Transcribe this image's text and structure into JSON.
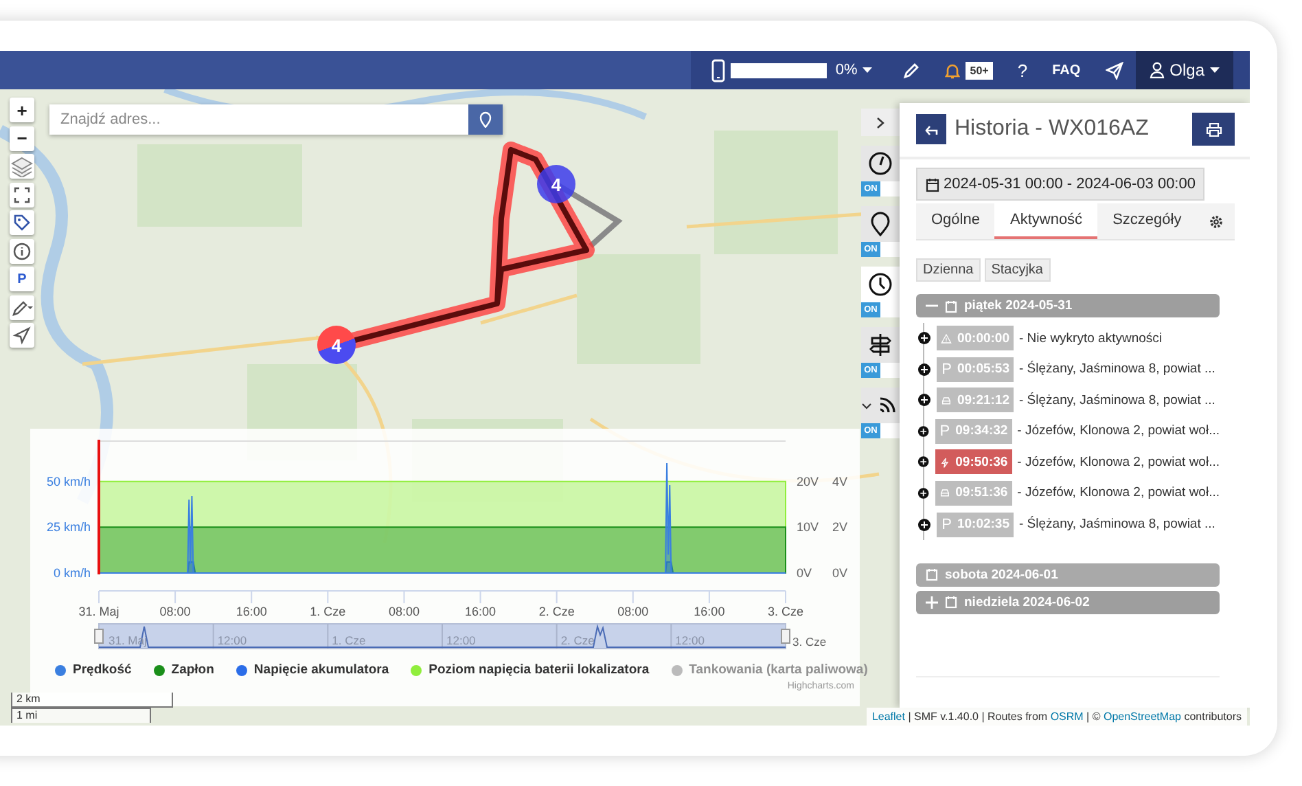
{
  "navbar": {
    "progress": {
      "level": 0,
      "reading": "0%"
    },
    "notifications_badge": "50+",
    "help": "?",
    "faq": "FAQ",
    "user": "Olga"
  },
  "map": {
    "search": {
      "placeholder": "Znajdź adres..."
    },
    "controls": [
      {
        "kind": "zoom_in",
        "label": "+"
      },
      {
        "kind": "zoom_out",
        "label": "−"
      },
      {
        "kind": "layers"
      },
      {
        "kind": "fullscreen"
      },
      {
        "kind": "tag"
      },
      {
        "kind": "info"
      },
      {
        "kind": "parking",
        "label": "P"
      },
      {
        "kind": "draw"
      },
      {
        "kind": "locate"
      }
    ],
    "markers": [
      {
        "kind": "start",
        "label": "4"
      },
      {
        "kind": "cluster",
        "label": "4"
      }
    ],
    "scale": [
      "2 km",
      "1 mi"
    ],
    "layer_toggles": [
      {
        "kind": "speed",
        "on": true,
        "selected": false,
        "label": "ON"
      },
      {
        "kind": "pin",
        "on": true,
        "selected": false,
        "label": "ON"
      },
      {
        "kind": "clock",
        "on": true,
        "selected": true,
        "label": "ON"
      },
      {
        "kind": "signpost",
        "on": true,
        "selected": false,
        "label": "ON"
      },
      {
        "kind": "signal",
        "on": true,
        "selected": false,
        "label": "ON"
      }
    ],
    "attribution": [
      {
        "text": "Leaflet",
        "link": true
      },
      {
        "text": "| SMF v.1.40.0 | Routes from",
        "link": false
      },
      {
        "text": "OSRM",
        "link": true
      },
      {
        "text": "| ©",
        "link": false
      },
      {
        "text": "OpenStreetMap",
        "link": true
      },
      {
        "text": "contributors",
        "link": false
      }
    ]
  },
  "chart": {
    "chart_data": {
      "type": "area",
      "x": [
        "2024-05-31 00:00",
        "2024-05-31 09:18",
        "2024-05-31 09:27",
        "2024-05-31 09:36",
        "2024-05-31 09:45",
        "2024-05-31 09:54",
        "2024-05-31 10:06",
        "2024-06-02 11:24",
        "2024-06-02 11:33",
        "2024-06-02 11:42",
        "2024-06-02 11:51",
        "2024-06-02 12:00",
        "2024-06-02 12:12",
        "2024-06-03 00:00"
      ],
      "xlim": [
        "2024-05-31 00:00",
        "2024-06-03 00:00"
      ],
      "ylim": [
        0,
        72
      ],
      "xticks": [
        {
          "value": "2024-05-31 00:00",
          "label": "31. Maj"
        },
        {
          "value": "2024-05-31 08:00",
          "label": "08:00"
        },
        {
          "value": "2024-05-31 16:00",
          "label": "16:00"
        },
        {
          "value": "2024-06-01 00:00",
          "label": "1. Cze"
        },
        {
          "value": "2024-06-01 08:00",
          "label": "08:00"
        },
        {
          "value": "2024-06-01 16:00",
          "label": "16:00"
        },
        {
          "value": "2024-06-02 00:00",
          "label": "2. Cze"
        },
        {
          "value": "2024-06-02 08:00",
          "label": "08:00"
        },
        {
          "value": "2024-06-02 16:00",
          "label": "16:00"
        },
        {
          "value": "2024-06-03 00:00",
          "label": "3. Cze"
        }
      ],
      "yticks": [
        {
          "value": 0,
          "label": "0 km/h"
        },
        {
          "value": 25,
          "label": "25 km/h"
        },
        {
          "value": 50,
          "label": "50 km/h"
        }
      ],
      "series": [
        {
          "name": "Prędkość",
          "color": "#3a7fe0",
          "values": [
            0,
            0,
            40,
            5,
            42,
            0,
            0,
            0,
            60,
            10,
            48,
            0,
            0,
            0
          ]
        },
        {
          "name": "Zapłon",
          "color": "#1a8f1a",
          "values": [
            25,
            25,
            25,
            25,
            25,
            25,
            25,
            25,
            25,
            25,
            25,
            25,
            25,
            25
          ]
        },
        {
          "name": "Napięcie akumulatora",
          "color": "#2b6de8",
          "values": [
            0,
            0,
            6,
            6,
            6,
            6,
            0,
            0,
            6,
            6,
            6,
            6,
            0,
            0
          ]
        },
        {
          "name": "Poziom napięcia baterii lokalizatora",
          "color": "#90ee3c",
          "values": [
            50,
            50,
            50,
            50,
            50,
            50,
            50,
            50,
            50,
            50,
            50,
            50,
            50,
            50
          ]
        },
        {
          "name": "Tankowania (karta paliwowa)",
          "color": "#bbbbbb",
          "values": [
            null,
            null,
            null,
            null,
            null,
            null,
            null,
            null,
            null,
            null,
            null,
            null,
            null,
            null
          ]
        }
      ]
    },
    "legend_states": [
      {
        "hidden": false
      },
      {
        "hidden": false
      },
      {
        "hidden": false
      },
      {
        "hidden": false
      },
      {
        "hidden": true
      }
    ],
    "right_axis_labels": [
      [
        "20V",
        "10V",
        "0V"
      ],
      [
        "4V",
        "2V",
        "0V"
      ]
    ],
    "navigator_labels": [
      "31. Maj",
      "12:00",
      "1. Cze",
      "12:00",
      "2. Cze",
      "12:00",
      "3. Cze"
    ],
    "credits": "Highcharts.com"
  },
  "panel": {
    "title": "Historia - WX016AZ",
    "date_range": "2024-05-31 00:00 - 2024-06-03 00:00",
    "tabs": [
      {
        "label": "Ogólne",
        "selected": false
      },
      {
        "label": "Aktywność",
        "selected": true
      },
      {
        "label": "Szczegóły",
        "selected": false
      }
    ],
    "filters": [
      "Dzienna",
      "Stacyjka"
    ],
    "days": [
      {
        "label": "piątek 2024-05-31",
        "expanded": true,
        "disabled": false,
        "events": [
          {
            "kind": "warning",
            "time": "00:00:00",
            "text": "- Nie wykryto aktywności"
          },
          {
            "kind": "parking",
            "symbol": "P",
            "time": "00:05:53",
            "text": "- Ślężany, Jaśminowa 8, powiat ..."
          },
          {
            "kind": "drive",
            "time": "09:21:12",
            "text": "- Ślężany, Jaśminowa 8, powiat ..."
          },
          {
            "kind": "parking",
            "symbol": "P",
            "time": "09:34:32",
            "text": "- Józefów, Klonowa 2, powiat woł..."
          },
          {
            "kind": "ignition",
            "time": "09:50:36",
            "text": "- Józefów, Klonowa 2, powiat woł..."
          },
          {
            "kind": "drive",
            "time": "09:51:36",
            "text": "- Józefów, Klonowa 2, powiat woł..."
          },
          {
            "kind": "parking",
            "symbol": "P",
            "time": "10:02:35",
            "text": "- Ślężany, Jaśminowa 8, powiat ..."
          }
        ]
      },
      {
        "label": "sobota 2024-06-01",
        "expanded": false,
        "disabled": true
      },
      {
        "label": "niedziela 2024-06-02",
        "expanded": false,
        "disabled": false
      }
    ]
  }
}
